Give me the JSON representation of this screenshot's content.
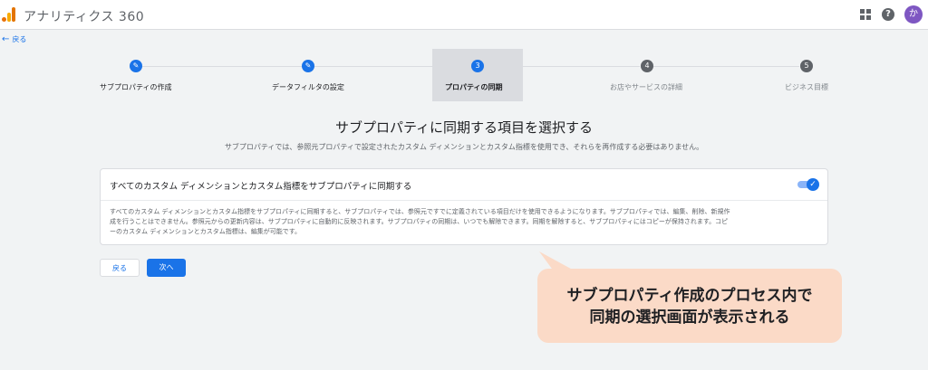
{
  "header": {
    "app_title": "アナリティクス 360",
    "avatar_initial": "か",
    "help_glyph": "?"
  },
  "back_link": {
    "label": "戻る"
  },
  "stepper": {
    "steps": [
      {
        "label": "サブプロパティの作成",
        "state": "done",
        "icon": "pencil-icon"
      },
      {
        "label": "データフィルタの設定",
        "state": "done",
        "icon": "pencil-icon"
      },
      {
        "label": "プロパティの同期",
        "state": "current",
        "number": "3"
      },
      {
        "label": "お店やサービスの詳細",
        "state": "todo",
        "number": "4"
      },
      {
        "label": "ビジネス目標",
        "state": "todo",
        "number": "5"
      }
    ]
  },
  "main": {
    "heading": "サブプロパティに同期する項目を選択する",
    "subtext": "サブプロパティでは、参照元プロパティで設定されたカスタム ディメンションとカスタム指標を使用でき、それらを再作成する必要はありません。"
  },
  "card": {
    "title": "すべてのカスタム ディメンションとカスタム指標をサブプロパティに同期する",
    "toggle_on": true,
    "body_lines": [
      "すべてのカスタム ディメンションとカスタム指標をサブプロパティに同期すると、サブプロパティでは、参照元ですでに定義されている項目だけを使用できるようになります。サブプロパティでは、編集、削除、新規作",
      "成を行うことはできません。参照元からの更新内容は、サブプロパティに自動的に反映されます。サブプロパティの同期は、いつでも解除できます。同期を解除すると、サブプロパティにはコピーが保持されます。コピ",
      "ーのカスタム ディメンションとカスタム指標は、編集が可能です。"
    ]
  },
  "buttons": {
    "back": "戻る",
    "next": "次へ"
  },
  "callout": {
    "line1": "サブプロパティ作成のプロセス内で",
    "line2": "同期の選択画面が表示される"
  },
  "colors": {
    "accent": "#1a73e8",
    "callout_bg": "#fbdac7"
  }
}
